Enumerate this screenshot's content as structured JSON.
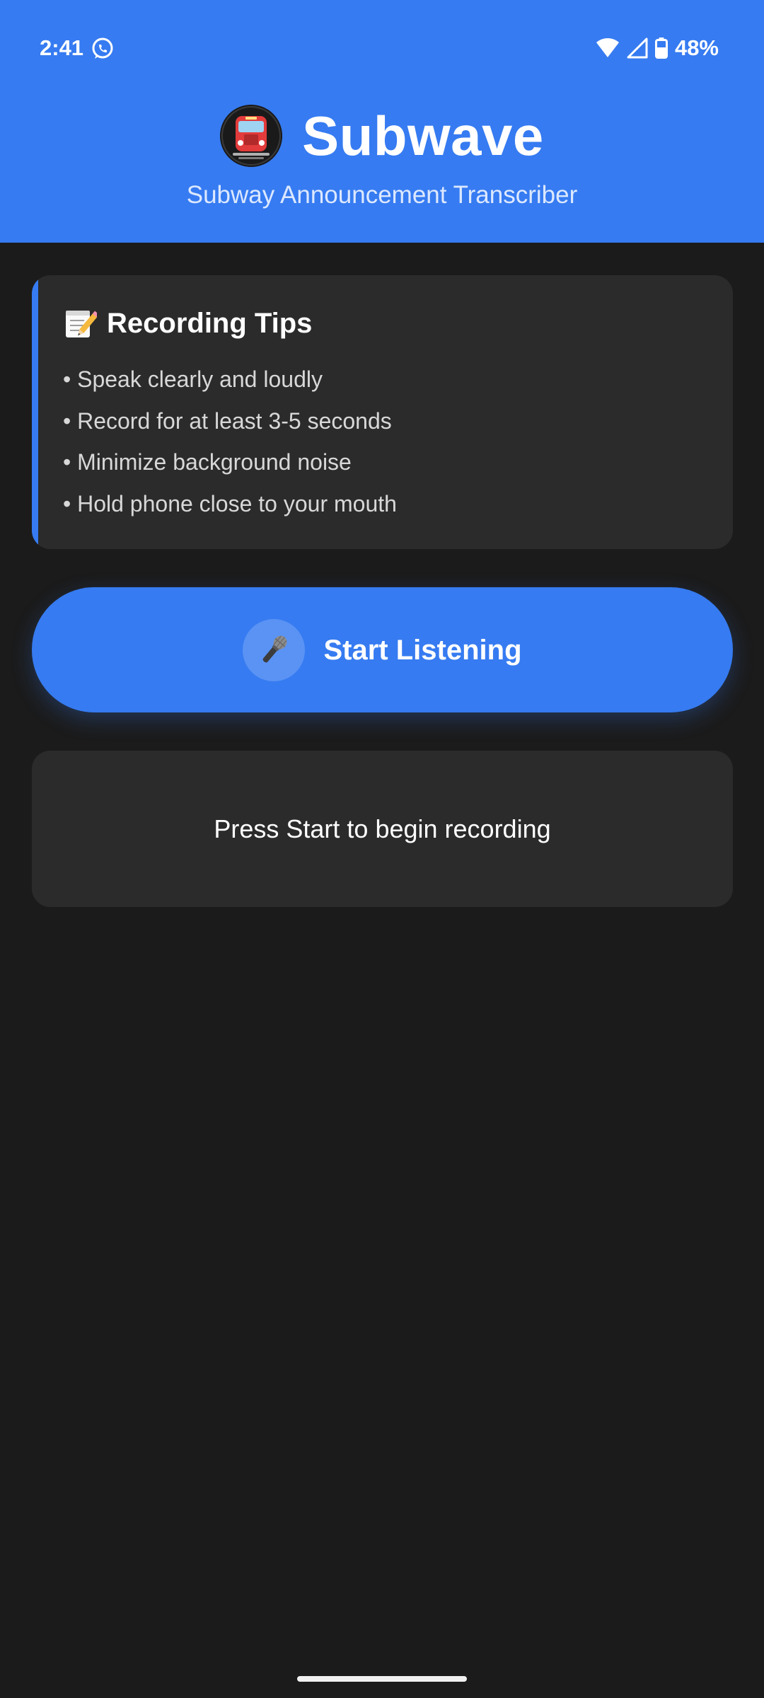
{
  "status_bar": {
    "time": "2:41",
    "battery": "48%",
    "notification_icon": "whatsapp-icon",
    "icons": [
      "wifi-icon",
      "signal-icon",
      "battery-icon"
    ]
  },
  "header": {
    "logo_icon": "subway-train-icon",
    "title": "Subwave",
    "subtitle": "Subway Announcement Transcriber"
  },
  "tips": {
    "icon": "memo-icon",
    "title": "Recording Tips",
    "items": [
      "• Speak clearly and loudly",
      "• Record for at least 3-5 seconds",
      "• Minimize background noise",
      "• Hold phone close to your mouth"
    ]
  },
  "start_button": {
    "icon": "microphone-icon",
    "label": "Start Listening"
  },
  "status": {
    "message": "Press Start to begin recording"
  },
  "colors": {
    "primary": "#367bf1",
    "background": "#1b1b1b",
    "card": "#2b2b2b",
    "text": "#ffffff",
    "muted_text": "#d8d8d8"
  }
}
